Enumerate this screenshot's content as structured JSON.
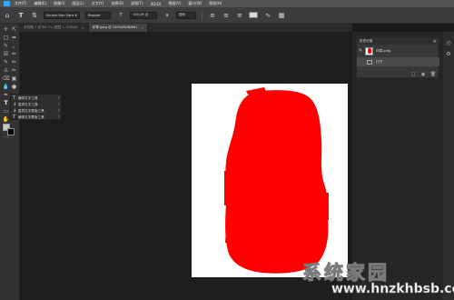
{
  "menu": [
    "文件(F)",
    "编辑(E)",
    "图像(I)",
    "图层(L)",
    "文字(Y)",
    "选择(S)",
    "滤镜(T)",
    "3D(D)",
    "视图(V)",
    "窗口(W)",
    "帮助(H)"
  ],
  "options": {
    "font_family": "Source Han Sans K",
    "font_style": "Regular",
    "font_size": "100.26 点",
    "antialias": "锐利",
    "text_color_hex": "#d8d8d8"
  },
  "tabs": [
    {
      "label": "未标题-1 @ 66.7% (图层 1, RGB/8)",
      "active": false
    },
    {
      "label": "印章.jpeg @ 100%(RGB/8#)",
      "active": true
    }
  ],
  "flyout": {
    "items": [
      {
        "label": "横排文字工具",
        "shortcut": "T"
      },
      {
        "label": "直排文字工具",
        "shortcut": "T"
      },
      {
        "label": "直排文字蒙版工具",
        "shortcut": "T"
      },
      {
        "label": "横排文字蒙版工具",
        "shortcut": "T"
      }
    ]
  },
  "history": {
    "title": "历史记录",
    "snapshot_label": "印章.jpeg",
    "states": [
      {
        "label": "打开"
      }
    ]
  },
  "canvas": {
    "background_color": "#ffffff",
    "stamp_color": "#ff0000"
  },
  "watermark": {
    "name": "系统家园",
    "url": "www.hnzkhbsb.com"
  },
  "colors": {
    "accent": "#31a8ff",
    "panel": "#383838",
    "workspace": "#1e1e1e"
  }
}
